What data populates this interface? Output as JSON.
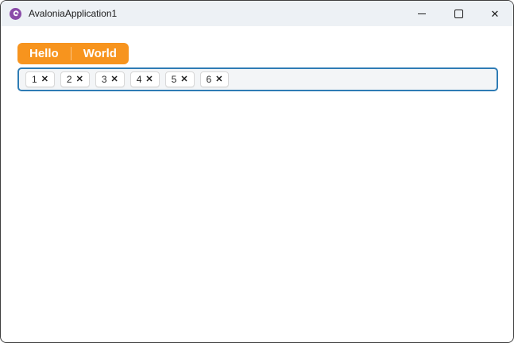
{
  "window": {
    "title": "AvaloniaApplication1",
    "app_icon": "avalonia-logo",
    "controls": [
      {
        "name": "minimize"
      },
      {
        "name": "maximize"
      },
      {
        "name": "close"
      }
    ]
  },
  "icons": {
    "close_glyph": "✕",
    "chip_remove_glyph": "✕"
  },
  "colors": {
    "accent_orange": "#F7941E",
    "focus_border_blue": "#2E7CB5",
    "titlebar_bg": "#EDF1F5",
    "logo_purple": "#8A4BA8",
    "chip_border": "#D8D8D8",
    "tagbox_bg": "#F3F5F7"
  },
  "toolbar": {
    "buttons": [
      {
        "label": "Hello"
      },
      {
        "label": "World"
      }
    ]
  },
  "chips": {
    "items": [
      {
        "label": "1"
      },
      {
        "label": "2"
      },
      {
        "label": "3"
      },
      {
        "label": "4"
      },
      {
        "label": "5"
      },
      {
        "label": "6"
      }
    ]
  }
}
